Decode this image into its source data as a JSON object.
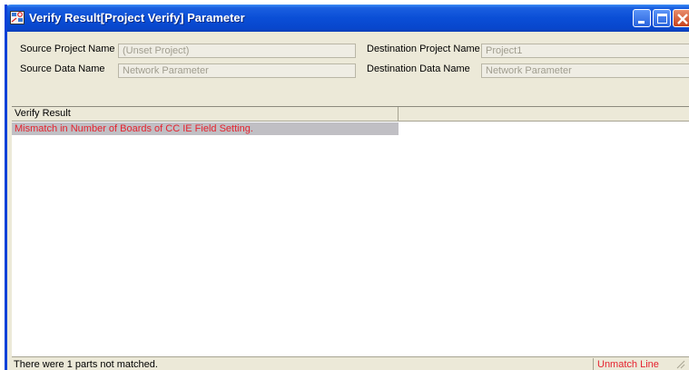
{
  "window": {
    "title": "Verify Result[Project Verify] Parameter",
    "icon": "verify-app-icon"
  },
  "source": {
    "project_label": "Source Project Name",
    "project_value": "(Unset Project)",
    "data_label": "Source Data Name",
    "data_value": "Network Parameter"
  },
  "destination": {
    "project_label": "Destination Project Name",
    "project_value": "Project1",
    "data_label": "Destination Data Name",
    "data_value": "Network Parameter"
  },
  "results": {
    "column_header": "Verify Result",
    "rows": [
      "Mismatch in Number of Boards of CC IE Field Setting."
    ]
  },
  "status": {
    "message": "There were 1 parts not matched.",
    "legend": "Unmatch Line"
  },
  "colors": {
    "titlebar": "#0a4ed6",
    "mismatch_text": "#e5232f",
    "mismatch_row_bg": "#c0bfc4",
    "window_bg": "#ece9d8"
  }
}
